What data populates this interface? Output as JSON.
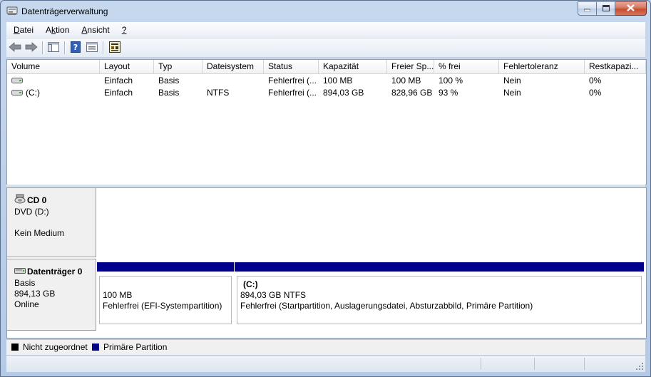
{
  "window": {
    "title": "Datenträgerverwaltung",
    "icon": "disk-management-icon"
  },
  "menu": [
    {
      "label": "Datei",
      "mnemonic": "D",
      "rest": "atei"
    },
    {
      "label": "Aktion",
      "mnemonic_pre": "A",
      "mnemonic": "k",
      "rest": "tion"
    },
    {
      "label": "Ansicht",
      "mnemonic": "A",
      "rest": "nsicht"
    },
    {
      "label": "?",
      "mnemonic": "?",
      "rest": ""
    }
  ],
  "toolbar": {
    "buttons": [
      "back-arrow-icon",
      "forward-arrow-icon",
      "console-tree-icon",
      "help-icon",
      "properties-pane-icon",
      "settings-icon"
    ]
  },
  "volume_list": {
    "columns": [
      "Volume",
      "Layout",
      "Typ",
      "Dateisystem",
      "Status",
      "Kapazität",
      "Freier Sp...",
      "% frei",
      "Fehlertoleranz",
      "Restkapazi..."
    ],
    "rows": [
      {
        "volume": "",
        "layout": "Einfach",
        "typ": "Basis",
        "dateisystem": "",
        "status": "Fehlerfrei (...",
        "kapazitaet": "100 MB",
        "frei": "100 MB",
        "prozent": "100 %",
        "fehlertoleranz": "Nein",
        "rest": "0%"
      },
      {
        "volume": "(C:)",
        "layout": "Einfach",
        "typ": "Basis",
        "dateisystem": "NTFS",
        "status": "Fehlerfrei (...",
        "kapazitaet": "894,03 GB",
        "frei": "828,96 GB",
        "prozent": "93 %",
        "fehlertoleranz": "Nein",
        "rest": "0%"
      }
    ]
  },
  "disks": [
    {
      "name": "CD 0",
      "line1": "DVD (D:)",
      "line2": "",
      "line3": "Kein Medium",
      "icon": "cd-drive-icon"
    },
    {
      "name": "Datenträger 0",
      "line1": "Basis",
      "line2": "894,13 GB",
      "line3": "Online",
      "icon": "hard-disk-icon",
      "partitions": [
        {
          "title": "",
          "size": "100 MB",
          "status": "Fehlerfrei (EFI-Systempartition)"
        },
        {
          "title": "(C:)",
          "size": "894,03 GB NTFS",
          "status": "Fehlerfrei (Startpartition, Auslagerungsdatei, Absturzabbild, Primäre Partition)"
        }
      ]
    }
  ],
  "legend": [
    {
      "label": "Nicht zugeordnet",
      "color": "#000000"
    },
    {
      "label": "Primäre Partition",
      "color": "#00008a"
    }
  ],
  "colors": {
    "primary_partition": "#00008a",
    "unallocated": "#000000"
  }
}
